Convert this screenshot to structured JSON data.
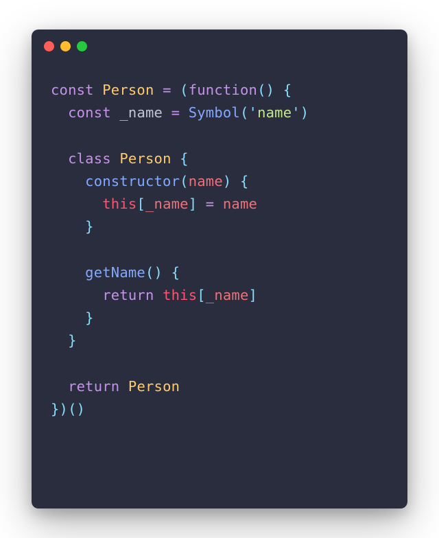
{
  "traffic_lights": {
    "red": "#ff5f56",
    "yellow": "#ffbd2e",
    "green": "#27c93f"
  },
  "code": {
    "l1": {
      "const": "const",
      "sp1": " ",
      "Person": "Person",
      "sp2": " ",
      "eq": "=",
      "sp3": " ",
      "lp": "(",
      "function": "function",
      "lp2": "(",
      "rp2": ")",
      "sp4": " ",
      "lb": "{"
    },
    "l2": {
      "indent": "  ",
      "const": "const",
      "sp1": " ",
      "name": "_name",
      "sp2": " ",
      "eq": "=",
      "sp3": " ",
      "Symbol": "Symbol",
      "lp": "(",
      "q1": "'",
      "str": "name",
      "q2": "'",
      "rp": ")"
    },
    "l3": {
      "blank": ""
    },
    "l4": {
      "indent": "  ",
      "class": "class",
      "sp1": " ",
      "Person": "Person",
      "sp2": " ",
      "lb": "{"
    },
    "l5": {
      "indent": "    ",
      "constructor": "constructor",
      "lp": "(",
      "param": "name",
      "rp": ")",
      "sp": " ",
      "lb": "{"
    },
    "l6": {
      "indent": "      ",
      "this": "this",
      "lsb": "[",
      "name": "_name",
      "rsb": "]",
      "sp1": " ",
      "eq": "=",
      "sp2": " ",
      "param": "name"
    },
    "l7": {
      "indent": "    ",
      "rb": "}"
    },
    "l8": {
      "blank": ""
    },
    "l9": {
      "indent": "    ",
      "getName": "getName",
      "lp": "(",
      "rp": ")",
      "sp": " ",
      "lb": "{"
    },
    "l10": {
      "indent": "      ",
      "return": "return",
      "sp": " ",
      "this": "this",
      "lsb": "[",
      "name": "_name",
      "rsb": "]"
    },
    "l11": {
      "indent": "    ",
      "rb": "}"
    },
    "l12": {
      "indent": "  ",
      "rb": "}"
    },
    "l13": {
      "blank": ""
    },
    "l14": {
      "indent": "  ",
      "return": "return",
      "sp": " ",
      "Person": "Person"
    },
    "l15": {
      "rb": "}",
      "rp": ")",
      "lp": "(",
      "rp2": ")"
    }
  }
}
